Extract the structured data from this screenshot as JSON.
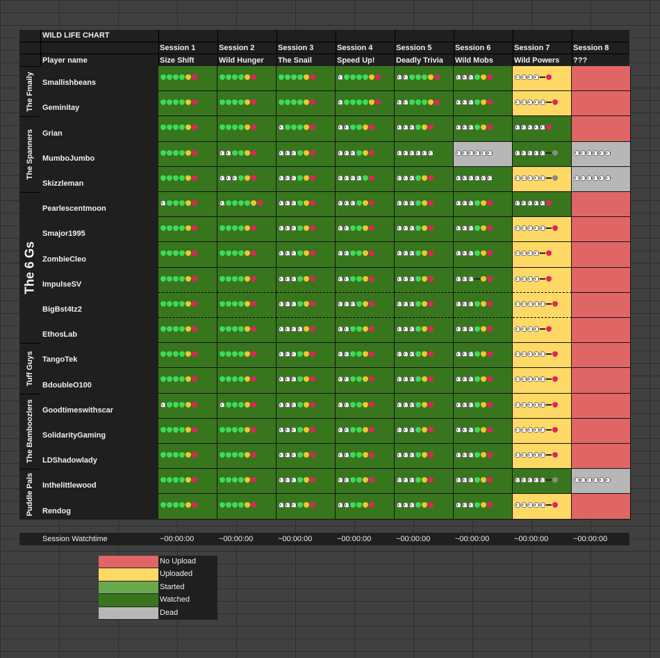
{
  "chart_title": "WILD LIFE CHART",
  "player_name_header": "Player name",
  "colors": {
    "no_upload": "#e06666",
    "uploaded": "#ffd966",
    "started": "#6aa84f",
    "watched": "#38761d",
    "dead": "#b7b7b7"
  },
  "sessions": [
    {
      "label": "Session 1",
      "title": "Size Shift",
      "watchtime": "~00:00:00"
    },
    {
      "label": "Session 2",
      "title": "Wild Hunger",
      "watchtime": "~00:00:00"
    },
    {
      "label": "Session 3",
      "title": "The Snail",
      "watchtime": "~00:00:00"
    },
    {
      "label": "Session 4",
      "title": "Speed Up!",
      "watchtime": "~00:00:00"
    },
    {
      "label": "Session 5",
      "title": "Deadly Trivia",
      "watchtime": "~00:00:00"
    },
    {
      "label": "Session 6",
      "title": "Wild Mobs",
      "watchtime": "~00:00:00"
    },
    {
      "label": "Session 7",
      "title": "Wild Powers",
      "watchtime": "~00:00:00"
    },
    {
      "label": "Session 8",
      "title": "???",
      "watchtime": "~00:00:00"
    }
  ],
  "watchtime_label": "Session Watchtime",
  "groups": [
    {
      "name": "The Fmaily",
      "rows": 2
    },
    {
      "name": "The Spanners",
      "rows": 3
    },
    {
      "name": "The 6 Gs",
      "rows": 6
    },
    {
      "name": "Tuff Guys",
      "rows": 2
    },
    {
      "name": "The Bamboozlers",
      "rows": 3
    },
    {
      "name": "Puddle Pals",
      "rows": 2
    }
  ],
  "players": [
    {
      "name": "Smallishbeans",
      "status": [
        "watched",
        "watched",
        "watched",
        "watched",
        "watched",
        "watched",
        "uploaded",
        "noupload"
      ],
      "lives": [
        "ggggyr",
        "ggggyr",
        "ggggyr",
        "sggggyr",
        "ssgggyr",
        "sssgyr",
        "ssss-r",
        ""
      ]
    },
    {
      "name": "Geminitay",
      "status": [
        "watched",
        "watched",
        "watched",
        "watched",
        "watched",
        "watched",
        "uploaded",
        "noupload"
      ],
      "lives": [
        "ggggyr",
        "ggggyr",
        "ggggyr",
        "sggggyr",
        "ssgggyr",
        "sssgyr",
        "sssss-r",
        ""
      ]
    },
    {
      "name": "Grian",
      "status": [
        "watched",
        "watched",
        "watched",
        "watched",
        "watched",
        "watched",
        "watched",
        "noupload"
      ],
      "lives": [
        "ggggyr",
        "ggggyr",
        "sgggyr",
        "ssggyr",
        "sssgyr",
        "sssgyr",
        "sssssr",
        ""
      ]
    },
    {
      "name": "MumboJumbo",
      "status": [
        "watched",
        "watched",
        "watched",
        "watched",
        "watched",
        "dead",
        "watched",
        "dead"
      ],
      "lives": [
        "ggggyr",
        "ssggyr",
        "sssgyr",
        "sssgyr",
        "ssssss",
        "ssssss",
        "sssss-e",
        "ssssss"
      ]
    },
    {
      "name": "Skizzleman",
      "status": [
        "watched",
        "watched",
        "watched",
        "watched",
        "watched",
        "watched",
        "uploaded",
        "dead"
      ],
      "lives": [
        "ggggyr",
        "sssgyr",
        "sssgyr",
        "ssssgr",
        "sssgyr",
        "ssssss",
        "sssss-e",
        "ssssss"
      ]
    },
    {
      "name": "Pearlescentmoon",
      "status": [
        "watched",
        "watched",
        "watched",
        "watched",
        "watched",
        "watched",
        "watched",
        "noupload"
      ],
      "lives": [
        "sgggyr",
        "sggggyr",
        "sssgyr",
        "sssgyr",
        "sssgyr",
        "sssgyr",
        "sssssr",
        ""
      ]
    },
    {
      "name": "Smajor1995",
      "status": [
        "watched",
        "watched",
        "watched",
        "watched",
        "watched",
        "watched",
        "uploaded",
        "noupload"
      ],
      "lives": [
        "ggggyr",
        "ggggyr",
        "sssgyr",
        "ssggyr",
        "sssgyr",
        "sssgyr",
        "sssss-r",
        ""
      ]
    },
    {
      "name": "ZombieCleo",
      "status": [
        "watched",
        "watched",
        "watched",
        "watched",
        "watched",
        "watched",
        "uploaded",
        "noupload"
      ],
      "lives": [
        "ggggyr",
        "ggggyr",
        "sssgyr",
        "ssggyr",
        "sssgyr",
        "sssgyr",
        "ssss-r",
        ""
      ]
    },
    {
      "name": "ImpulseSV",
      "status": [
        "watched",
        "watched",
        "watched",
        "watched",
        "watched",
        "watched",
        "uploaded",
        "noupload"
      ],
      "lives": [
        "ggggyr",
        "ggggyr",
        "sssgyr",
        "ssggyr",
        "sssgyr",
        "sss-yr",
        "ssss-r",
        ""
      ]
    },
    {
      "name": "BigBst4tz2",
      "status": [
        "watched",
        "watched",
        "watched",
        "watched",
        "watched",
        "watched",
        "uploaded",
        "noupload"
      ],
      "lives": [
        "ggggyr",
        "ggggyr",
        "sssgyr",
        "sssgyr",
        "sssgyr",
        "sssgyr",
        "sssss-r",
        ""
      ]
    },
    {
      "name": "EthosLab",
      "status": [
        "watched",
        "watched",
        "watched",
        "watched",
        "watched",
        "watched",
        "uploaded",
        "noupload"
      ],
      "lives": [
        "ggggyr",
        "ggggyr",
        "ssssyr",
        "ssggyr",
        "sssgyr",
        "sssgyr",
        "ssss-r",
        ""
      ]
    },
    {
      "name": "TangoTek",
      "status": [
        "watched",
        "watched",
        "watched",
        "watched",
        "watched",
        "watched",
        "uploaded",
        "noupload"
      ],
      "lives": [
        "ggggyr",
        "ggggyr",
        "sssgyr",
        "ssggyr",
        "sssgyr",
        "sssgyr",
        "sssss-r",
        ""
      ]
    },
    {
      "name": "BdoubleO100",
      "status": [
        "watched",
        "watched",
        "watched",
        "watched",
        "watched",
        "watched",
        "uploaded",
        "noupload"
      ],
      "lives": [
        "ggggyr",
        "ggggyr",
        "sssgyr",
        "ssggyr",
        "sssgyr",
        "sssgyr",
        "sssss-r",
        ""
      ]
    },
    {
      "name": "Goodtimeswithscar",
      "status": [
        "watched",
        "watched",
        "watched",
        "watched",
        "watched",
        "watched",
        "uploaded",
        "noupload"
      ],
      "lives": [
        "sgggyr",
        "sgggyr",
        "sssgyr",
        "ssggyr",
        "sssgyr",
        "sssgyr",
        "sssss-r",
        ""
      ]
    },
    {
      "name": "SolidarityGaming",
      "status": [
        "watched",
        "watched",
        "watched",
        "watched",
        "watched",
        "watched",
        "uploaded",
        "noupload"
      ],
      "lives": [
        "ggggyr",
        "ggggyr",
        "sssgyr",
        "ssggyr",
        "sssgyr",
        "sssgyr",
        "sssss-r",
        ""
      ]
    },
    {
      "name": "LDShadowlady",
      "status": [
        "watched",
        "watched",
        "watched",
        "watched",
        "watched",
        "watched",
        "uploaded",
        "noupload"
      ],
      "lives": [
        "ggggyr",
        "ggggyr",
        "sssgyr",
        "ssggyr",
        "sssgyr",
        "sssgyr",
        "sssss-r",
        ""
      ]
    },
    {
      "name": "Inthelittlewood",
      "status": [
        "watched",
        "watched",
        "watched",
        "watched",
        "watched",
        "watched",
        "watched",
        "dead"
      ],
      "lives": [
        "ggggyr",
        "ggggyr",
        "sssgyr",
        "ssggyr",
        "sssgyr",
        "sssgyr",
        "sssss-e",
        "ssssss"
      ]
    },
    {
      "name": "Rendog",
      "status": [
        "watched",
        "watched",
        "watched",
        "watched",
        "watched",
        "watched",
        "uploaded",
        "noupload"
      ],
      "lives": [
        "ggggyr",
        "ggggyr",
        "sssgyr",
        "ssggyr",
        "sssgyr",
        "sssgyr",
        "sssss-r",
        ""
      ]
    }
  ],
  "legend": [
    {
      "label": "No Upload",
      "color": "#e06666"
    },
    {
      "label": "Uploaded",
      "color": "#ffd966"
    },
    {
      "label": "Started",
      "color": "#6aa84f"
    },
    {
      "label": "Watched",
      "color": "#38761d"
    },
    {
      "label": "Dead",
      "color": "#b7b7b7"
    }
  ]
}
